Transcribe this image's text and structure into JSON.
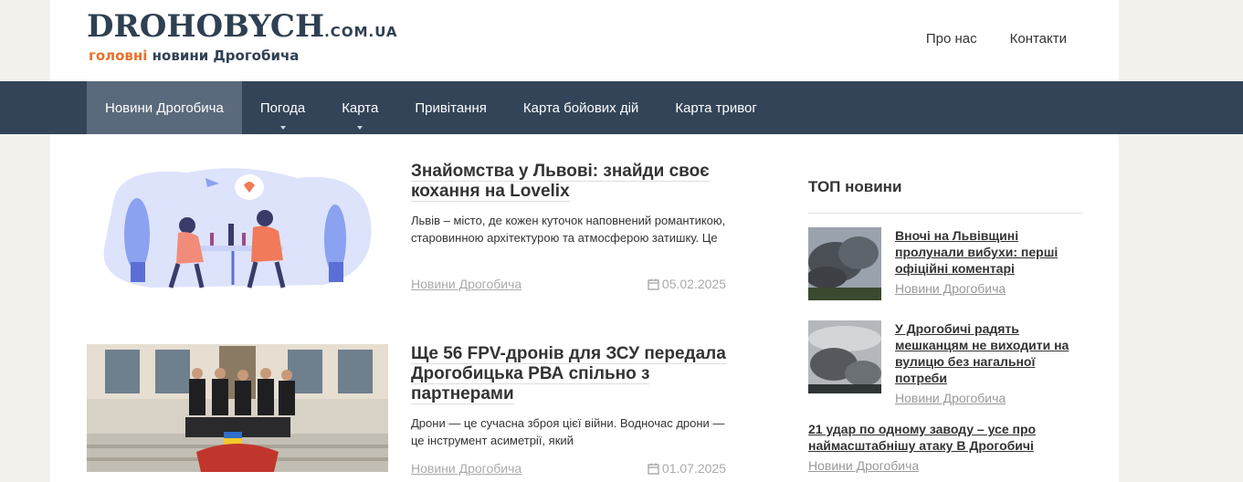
{
  "brand": {
    "name": "DROHOBYCH",
    "tld": ".COM.UA",
    "tagline_accent": "головні",
    "tagline_rest": " новини Дрогобича",
    "colors": {
      "primary": "#334459",
      "accent": "#e8712a",
      "active_tab": "#5a6a7c"
    }
  },
  "top_links": [
    "Про нас",
    "Контакти"
  ],
  "nav": [
    {
      "label": "Новини Дрогобича",
      "active": true,
      "dropdown": false
    },
    {
      "label": "Погода",
      "active": false,
      "dropdown": true
    },
    {
      "label": "Карта",
      "active": false,
      "dropdown": true
    },
    {
      "label": "Привітання",
      "active": false,
      "dropdown": false
    },
    {
      "label": "Карта бойових дій",
      "active": false,
      "dropdown": false
    },
    {
      "label": "Карта тривог",
      "active": false,
      "dropdown": false
    }
  ],
  "articles": [
    {
      "title": "Знайомства у Львові: знайди своє кохання на Lovelix",
      "excerpt": "Львів – місто, де кожен куточок наповнений романтикою, старовинною архітектурою та атмосферою затишку. Це",
      "category": "Новини Дрогобича",
      "date": "05.02.2025"
    },
    {
      "title": "Ще 56 FPV-дронів для ЗСУ передала Дрогобицька РВА спільно з партнерами",
      "excerpt": "Дрони — це сучасна зброя цієї війни. Водночас дрони — це інструмент асиметрії, який",
      "category": "Новини Дрогобича",
      "date": "01.07.2025"
    }
  ],
  "sidebar": {
    "title": "ТОП новини",
    "items": [
      {
        "title": "Вночі на Львівщині пролунали вибухи: перші офіційні коментарі",
        "category": "Новини Дрогобича"
      },
      {
        "title": "У Дрогобичі радять мешканцям не виходити на вулицю без нагальної потреби",
        "category": "Новини Дрогобича"
      },
      {
        "title": "21 удар по одному заводу – усе про наймасштабнішу атаку В Дрогобичі",
        "category": "Новини Дрогобича"
      }
    ]
  }
}
